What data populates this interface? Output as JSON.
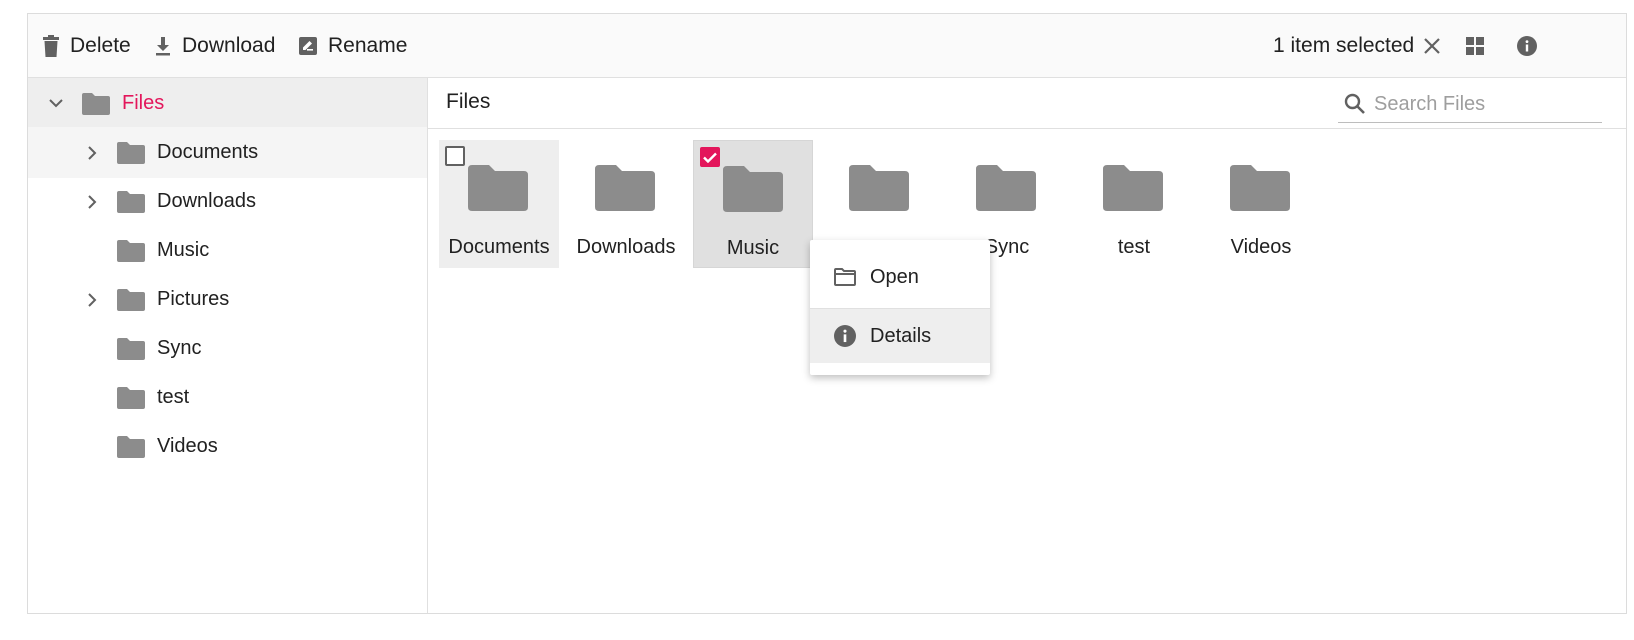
{
  "toolbar": {
    "delete_label": "Delete",
    "download_label": "Download",
    "rename_label": "Rename",
    "selection_text": "1 item selected"
  },
  "navigation": {
    "root": "Files",
    "items": [
      {
        "label": "Documents",
        "expandable": true
      },
      {
        "label": "Downloads",
        "expandable": true
      },
      {
        "label": "Music",
        "expandable": false
      },
      {
        "label": "Pictures",
        "expandable": true
      },
      {
        "label": "Sync",
        "expandable": false
      },
      {
        "label": "test",
        "expandable": false
      },
      {
        "label": "Videos",
        "expandable": false
      }
    ]
  },
  "main": {
    "breadcrumb": "Files",
    "search_placeholder": "Search Files",
    "items": [
      "Documents",
      "Downloads",
      "Music",
      "",
      "Sync",
      "test",
      "Videos"
    ],
    "selected_item": "Music"
  },
  "context_menu": {
    "open_label": "Open",
    "details_label": "Details"
  },
  "colors": {
    "accent": "#e3165b",
    "folder": "#8c8c8c",
    "icon": "#616161"
  }
}
